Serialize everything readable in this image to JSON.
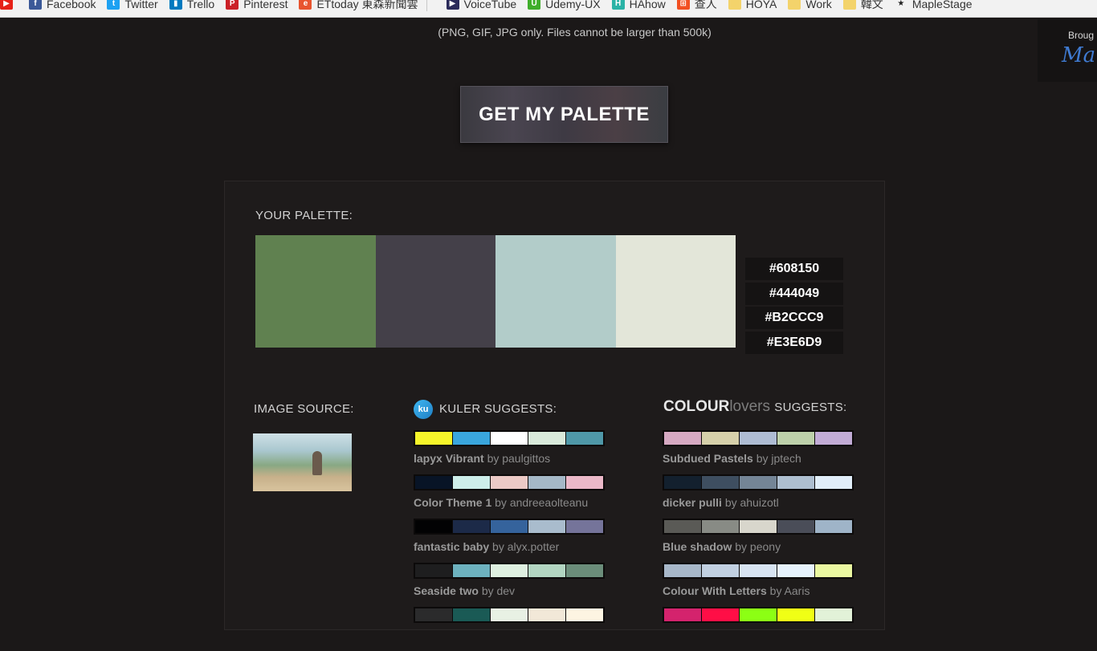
{
  "bookmarks": [
    {
      "label": "",
      "icon": "youtube-icon",
      "color": "#e62117"
    },
    {
      "label": "Facebook",
      "icon": "facebook-icon",
      "color": "#3b5998"
    },
    {
      "label": "Twitter",
      "icon": "twitter-icon",
      "color": "#1da1f2"
    },
    {
      "label": "Trello",
      "icon": "trello-icon",
      "color": "#0079bf"
    },
    {
      "label": "Pinterest",
      "icon": "pinterest-icon",
      "color": "#cb2027"
    },
    {
      "label": "ETtoday 東森新聞雲",
      "icon": "ettoday-icon",
      "color": "#e8542f"
    },
    {
      "label": "VoiceTube",
      "icon": "voicetube-icon",
      "color": "#2a2a5a"
    },
    {
      "label": "Udemy-UX",
      "icon": "udemy-icon",
      "color": "#3fae2a"
    },
    {
      "label": "HAhow",
      "icon": "hahow-icon",
      "color": "#2ab3a6"
    },
    {
      "label": "查人",
      "icon": "windows-icon",
      "color": "#f25022"
    },
    {
      "label": "HOYA",
      "icon": "folder-icon",
      "color": "#f3d36b"
    },
    {
      "label": "Work",
      "icon": "folder-icon",
      "color": "#f3d36b"
    },
    {
      "label": "韓文",
      "icon": "folder-icon",
      "color": "#f3d36b"
    },
    {
      "label": "MapleStage",
      "icon": "star-icon",
      "color": "#222222"
    }
  ],
  "upload_note": "(PNG, GIF, JPG only. Files cannot be larger than 500k)",
  "corner_ad": {
    "line1": "Broug",
    "line2": "Ma"
  },
  "get_palette_label": "GET MY PALETTE",
  "palette": {
    "heading": "YOUR PALETTE:",
    "colors": [
      "#608150",
      "#444049",
      "#B2CCC9",
      "#E3E6D9"
    ]
  },
  "image_source": {
    "heading": "IMAGE SOURCE:"
  },
  "kuler": {
    "logo_text": "ku",
    "heading": "KULER SUGGESTS:",
    "items": [
      {
        "name": "lapyx Vibrant",
        "by": "by paulgittos",
        "colors": [
          "#f6f52a",
          "#3aa6dd",
          "#ffffff",
          "#d9eadb",
          "#4f98a8"
        ]
      },
      {
        "name": "Color Theme 1",
        "by": "by andreeaolteanu",
        "colors": [
          "#081426",
          "#cdeeea",
          "#eccac6",
          "#a5b8c7",
          "#eab8c8"
        ]
      },
      {
        "name": "fantastic baby",
        "by": "by alyx.potter",
        "colors": [
          "#020203",
          "#1c2a48",
          "#35639c",
          "#a9bccd",
          "#75749a"
        ]
      },
      {
        "name": "Seaside two",
        "by": "by dev",
        "colors": [
          "#1e1e1f",
          "#6db2bf",
          "#deefe0",
          "#b2d5c1",
          "#6b8d7a"
        ]
      },
      {
        "name": "",
        "by": "",
        "colors": [
          "#2b2b2c",
          "#1a5a55",
          "#e8f1e4",
          "#f2e8d8",
          "#fdf4e2"
        ]
      }
    ]
  },
  "colourlovers": {
    "logo_bold": "COLOUR",
    "logo_light": "lovers",
    "heading": "SUGGESTS:",
    "items": [
      {
        "name": "Subdued Pastels",
        "by": "by jptech",
        "colors": [
          "#d6a9c2",
          "#d6d0aa",
          "#aebcd3",
          "#bdd0aa",
          "#c2acd6"
        ]
      },
      {
        "name": "dicker pulli",
        "by": "by ahuizotl",
        "colors": [
          "#13202e",
          "#3e4e60",
          "#748596",
          "#aebfd0",
          "#e1eef9"
        ]
      },
      {
        "name": "Blue shadow",
        "by": "by peony",
        "colors": [
          "#5a5a56",
          "#888b85",
          "#d8d6cc",
          "#4a4d58",
          "#9fb4c8"
        ]
      },
      {
        "name": "Colour With Letters",
        "by": "by Aaris",
        "colors": [
          "#a7b7c9",
          "#c1d0e1",
          "#d7e3f1",
          "#e6f2fc",
          "#eaf7a0"
        ]
      },
      {
        "name": "",
        "by": "",
        "colors": [
          "#d4236d",
          "#ff0e46",
          "#8cff14",
          "#f0ff15",
          "#e2f2d8"
        ]
      }
    ]
  }
}
